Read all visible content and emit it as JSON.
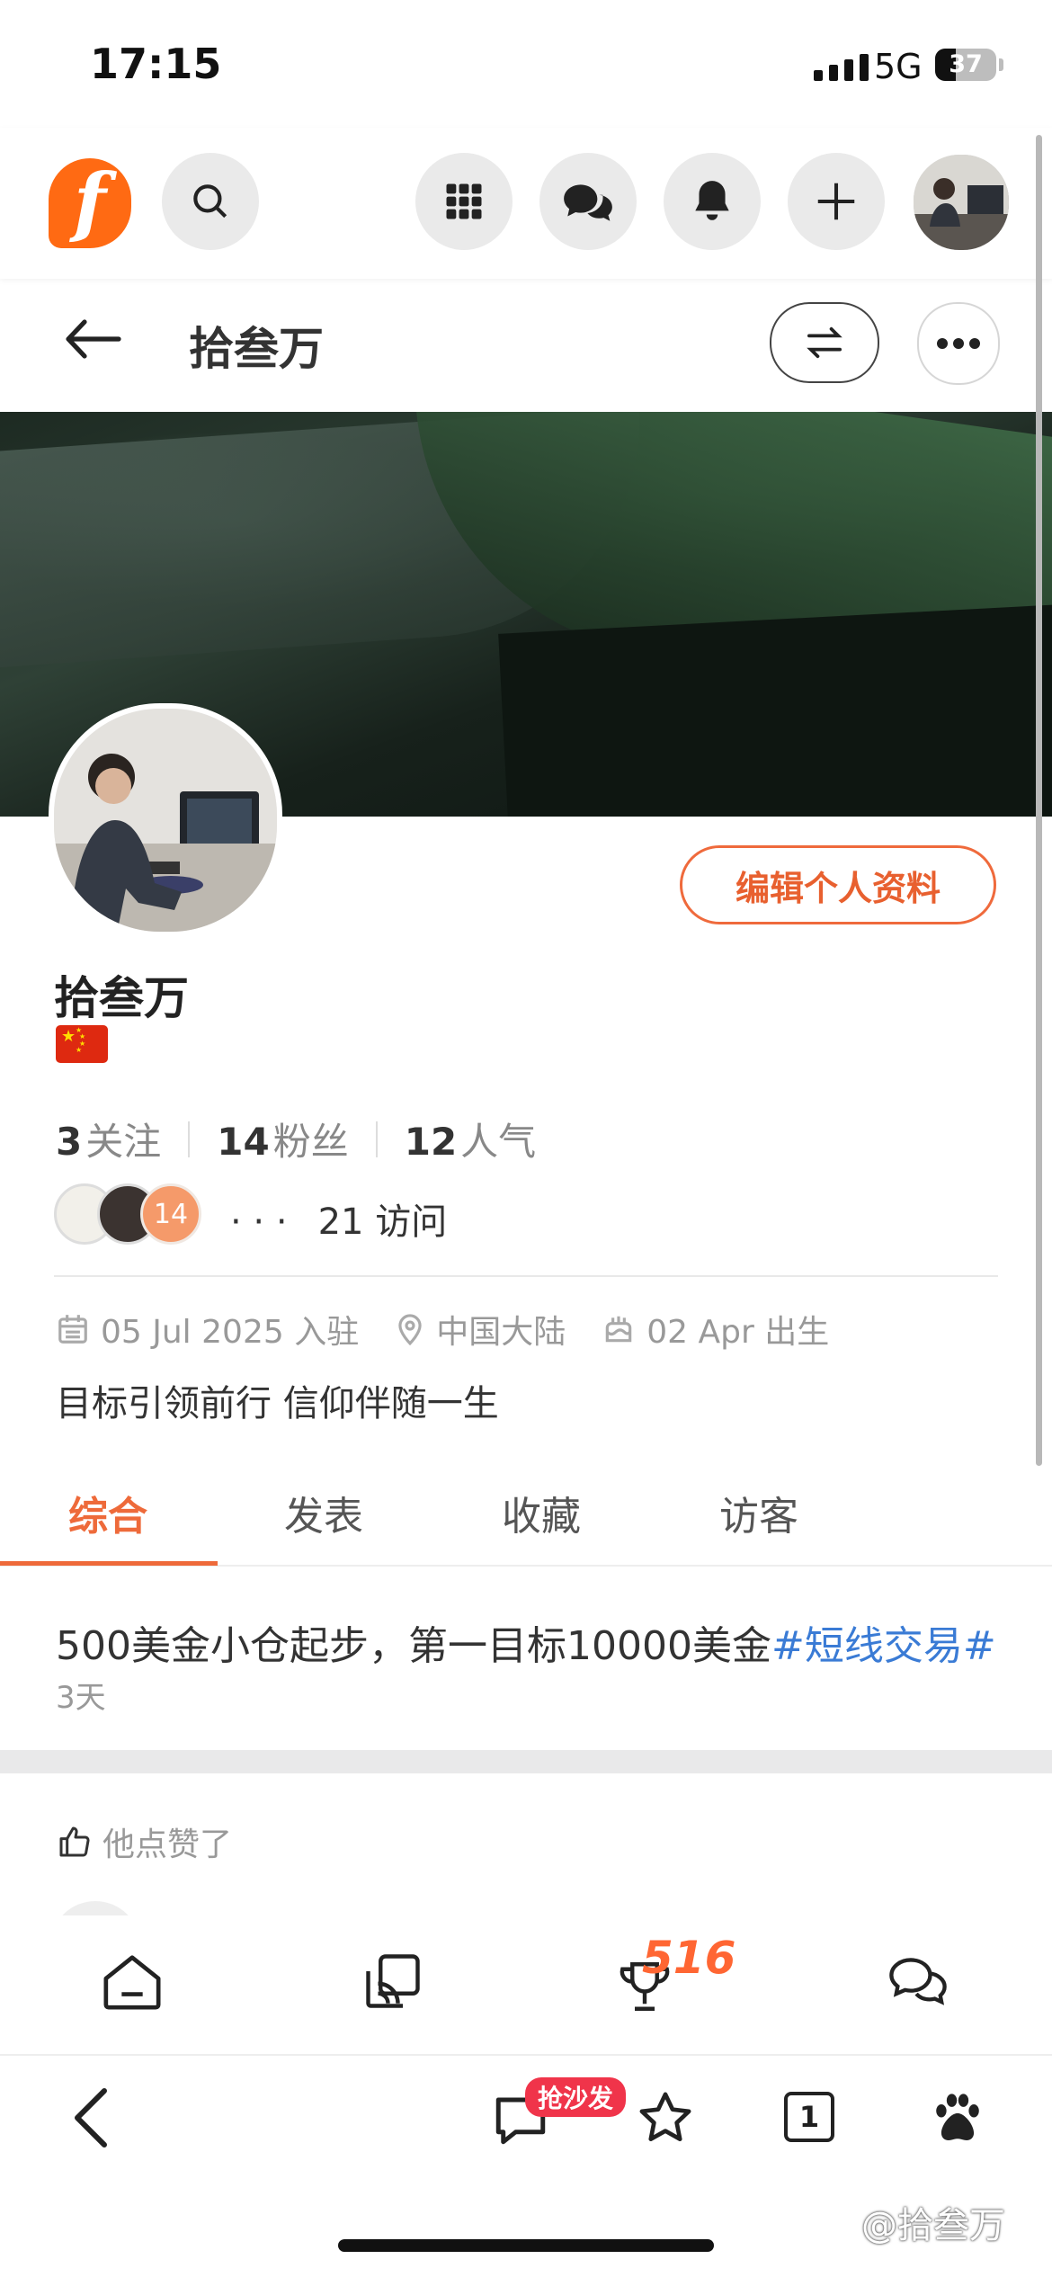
{
  "status_bar": {
    "time": "17:15",
    "network": "5G",
    "battery": "37"
  },
  "nav": {
    "logo_letter": "f",
    "icons": [
      "search-icon",
      "apps-grid-icon",
      "chat-bubbles-icon",
      "bell-icon",
      "plus-icon"
    ]
  },
  "header": {
    "title": "拾叁万"
  },
  "profile": {
    "name": "拾叁万",
    "edit_label": "编辑个人资料",
    "stats": [
      {
        "value": "3",
        "label": "关注"
      },
      {
        "value": "14",
        "label": "粉丝"
      },
      {
        "value": "12",
        "label": "人气"
      }
    ],
    "fans_badge": "14",
    "visits_dots": "· · ·",
    "visits": "21 访问",
    "joined": "05 Jul 2025 入驻",
    "location": "中国大陆",
    "birthday": "02 Apr 出生",
    "bio": "目标引领前行 信仰伴随一生"
  },
  "tabs": [
    "综合",
    "发表",
    "收藏",
    "访客"
  ],
  "post": {
    "text": "500美金小仓起步，第一目标10000美金",
    "tag": "#短线交易#",
    "time": "3天"
  },
  "liked_label": "他点赞了",
  "app_bar": {
    "trophy_badge": "516"
  },
  "browser_bar": {
    "sofa_label": "抢沙发",
    "tab_count": "1"
  },
  "watermark": "@拾叁万",
  "colors": {
    "accent": "#ee6a3a",
    "logo": "#ff6a13",
    "tag": "#3a7bd5",
    "sofa": "#f0344a"
  }
}
